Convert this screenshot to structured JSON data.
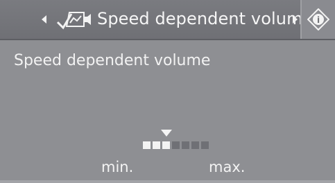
{
  "title": {
    "text": "Speed dependent volume",
    "left_arrow_icon": "chevron-left-icon",
    "right_arrow_icon": "chevron-right-icon",
    "menu_icon": "speed-volume-icon",
    "info_icon": "info-icon"
  },
  "content": {
    "label": "Speed dependent volume"
  },
  "volume_scale": {
    "level": 3,
    "steps": 7,
    "min_label": "min.",
    "max_label": "max."
  },
  "colors": {
    "background": "#8e8f93",
    "titlebar": "#707176",
    "text": "#f3f3f3",
    "bar_off": "#6f7075"
  }
}
